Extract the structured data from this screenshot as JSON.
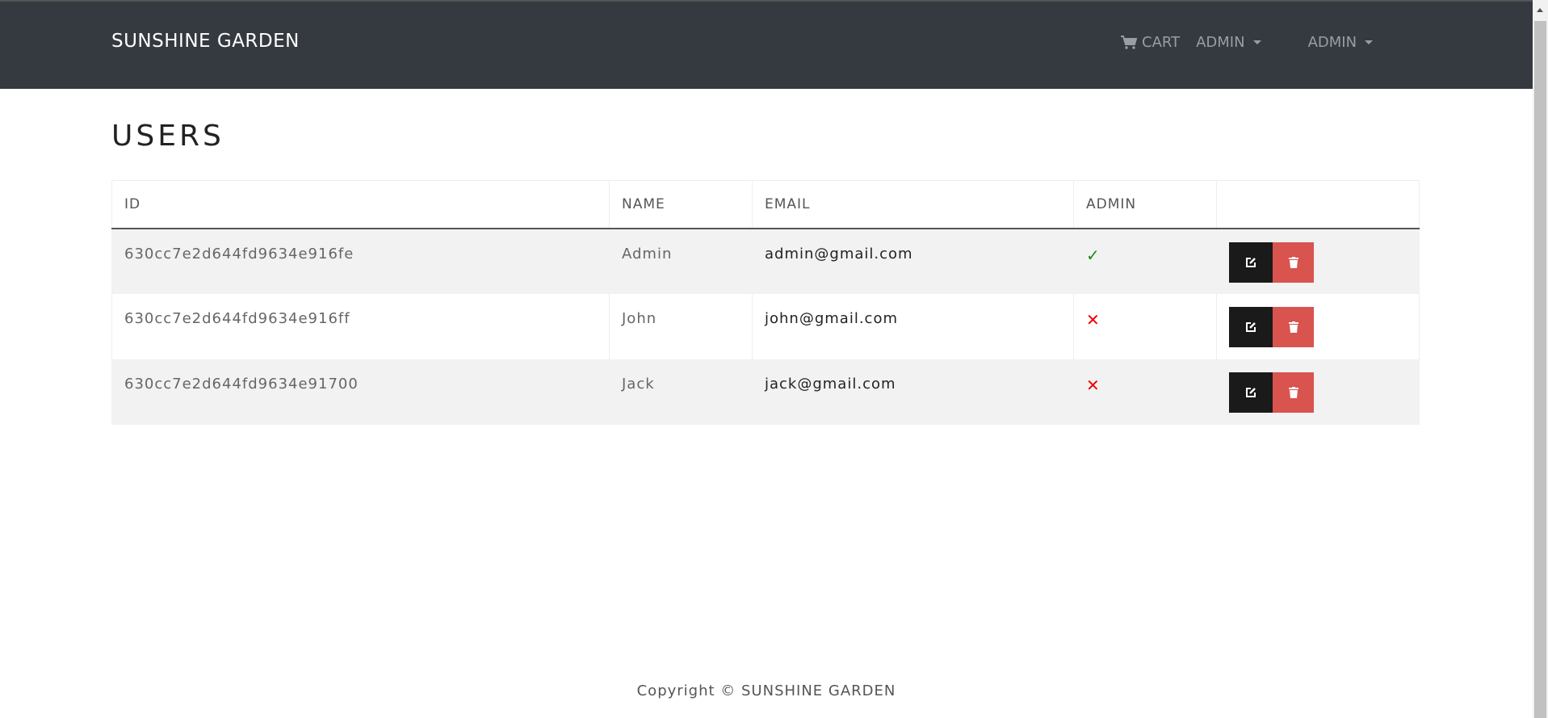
{
  "navbar": {
    "brand": "SUNSHINE GARDEN",
    "cart": "CART",
    "user_menu": "ADMIN",
    "admin_menu": "ADMIN"
  },
  "page": {
    "title": "USERS"
  },
  "table": {
    "headers": [
      "ID",
      "NAME",
      "EMAIL",
      "ADMIN",
      ""
    ],
    "rows": [
      {
        "id": "630cc7e2d644fd9634e916fe",
        "name": "Admin",
        "email": "admin@gmail.com",
        "admin_icon": "✓"
      },
      {
        "id": "630cc7e2d644fd9634e916ff",
        "name": "John",
        "email": "john@gmail.com",
        "admin_icon": "✕"
      },
      {
        "id": "630cc7e2d644fd9634e91700",
        "name": "Jack",
        "email": "jack@gmail.com",
        "admin_icon": "✕"
      }
    ]
  },
  "footer": {
    "text": "Copyright © SUNSHINE GARDEN"
  },
  "colors": {
    "navbar": "#343a40",
    "delete": "#d9534f",
    "edit": "#1a1a1a",
    "yes": "#1a8a1a",
    "no": "#e00000"
  }
}
